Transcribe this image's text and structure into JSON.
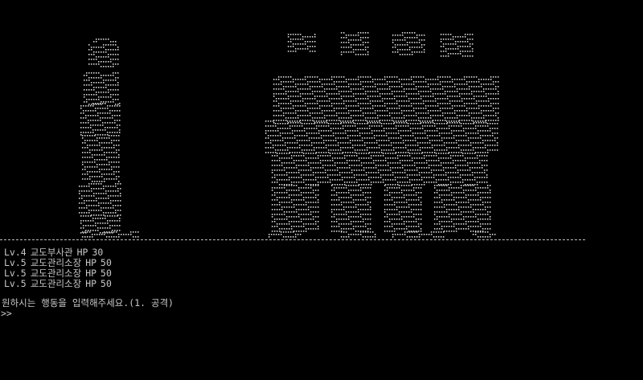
{
  "enemies": [
    {
      "level": "Lv.4",
      "name": "교도부사관",
      "hp_label": "HP",
      "hp": "30"
    },
    {
      "level": "Lv.5",
      "name": "교도관리소장",
      "hp_label": "HP",
      "hp": "50"
    },
    {
      "level": "Lv.5",
      "name": "교도관리소장",
      "hp_label": "HP",
      "hp": "50"
    },
    {
      "level": "Lv.5",
      "name": "교도관리소장",
      "hp_label": "HP",
      "hp": "50"
    }
  ],
  "prompt_text": "원하시는 행동을 입력해주세요.(1. 공격)",
  "input_prefix": ">>",
  "colors": {
    "background": "#000000",
    "text": "#c8c8c8",
    "art": "#d0d0d0"
  }
}
